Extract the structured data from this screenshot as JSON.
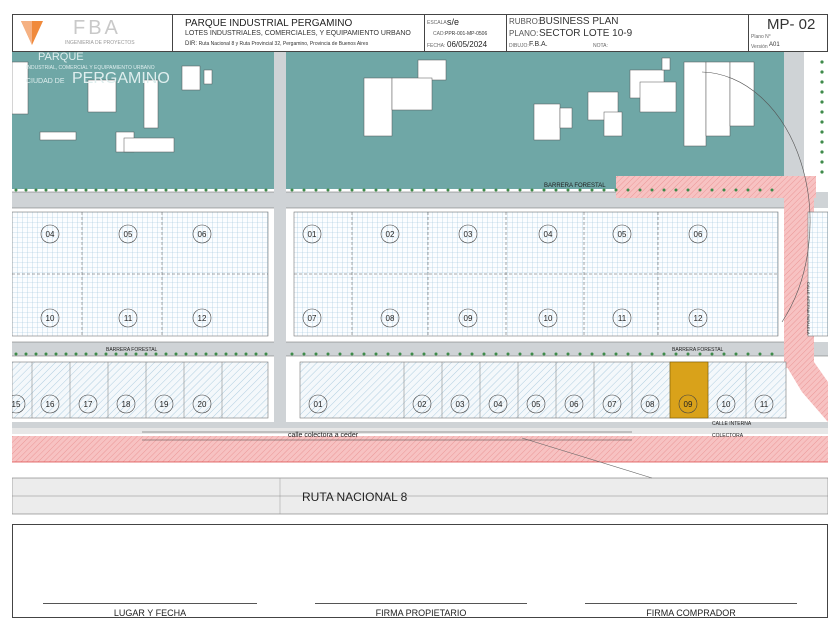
{
  "header": {
    "logo_text": "FBA",
    "logo_sub": "INGENIERIA DE PROYECTOS",
    "project_title": "PARQUE INDUSTRIAL PERGAMINO",
    "project_subtitle": "LOTES INDUSTRIALES, COMERCIALES, Y EQUIPAMIENTO URBANO",
    "dir_label": "DIR:",
    "dir_value": "Ruta Nacional 8 y Ruta Provincial 32, Pergamino, Provincia de Buenos Aires",
    "escala_label": "ESCALA:",
    "escala_value": "s/e",
    "cad_label": "CAD:",
    "cad_value": "PPR-001-MP-0506",
    "fecha_label": "FECHA:",
    "fecha_value": "06/05/2024",
    "rubro_label": "RUBRO:",
    "rubro_value": "BUSINESS PLAN",
    "plano_label": "PLANO:",
    "plano_value": "SECTOR LOTE 10-9",
    "dibujo_label": "DIBUJO:",
    "dibujo_value": "F.B.A.",
    "nota_label": "NOTA:",
    "plan_number": "MP- 02",
    "plano_n_label": "Plano N°",
    "version_label": "Versión",
    "version_value": "A01"
  },
  "map": {
    "park_wordmark_1": "PARQUE",
    "park_wordmark_2": "INDUSTRIAL, COMERCIAL Y EQUIPAMIENTO URBANO",
    "park_wordmark_3": "CIUDAD DE",
    "park_wordmark_4": "PERGAMINO",
    "barrier_top": "BARRERA FORESTAL",
    "barrier_mid_left": "BARRERA FORESTAL",
    "barrier_mid_right": "BARRERA FORESTAL",
    "calle_interna_paralela": "CALLE INTERNA PARALELA",
    "calle_interna": "CALLE INTERNA",
    "colectora": "COLECTORA",
    "calle_colectora": "calle colectora a ceder",
    "ruta": "RUTA NACIONAL 8",
    "row_a_left": [
      "04",
      "05",
      "06"
    ],
    "row_a_right": [
      "01",
      "02",
      "03",
      "04",
      "05",
      "06"
    ],
    "row_b_left": [
      "10",
      "11",
      "12"
    ],
    "row_b_right": [
      "07",
      "08",
      "09",
      "10",
      "11",
      "12"
    ],
    "row_c_left": [
      "15",
      "16",
      "17",
      "18",
      "19",
      "20"
    ],
    "row_c_right": [
      "01",
      "02",
      "03",
      "04",
      "05",
      "06",
      "07",
      "08",
      "09",
      "10",
      "11"
    ],
    "highlight_lot": "09"
  },
  "colors": {
    "existing_area": "#6fa7a6",
    "lot_hatch": "#9fc3d9",
    "highlight": "#d9a21a",
    "road_red": "#f2a5a5",
    "tree": "#3e8b4a"
  },
  "signatures": {
    "lugar": "LUGAR Y FECHA",
    "propietario": "FIRMA PROPIETARIO",
    "comprador": "FIRMA COMPRADOR"
  }
}
